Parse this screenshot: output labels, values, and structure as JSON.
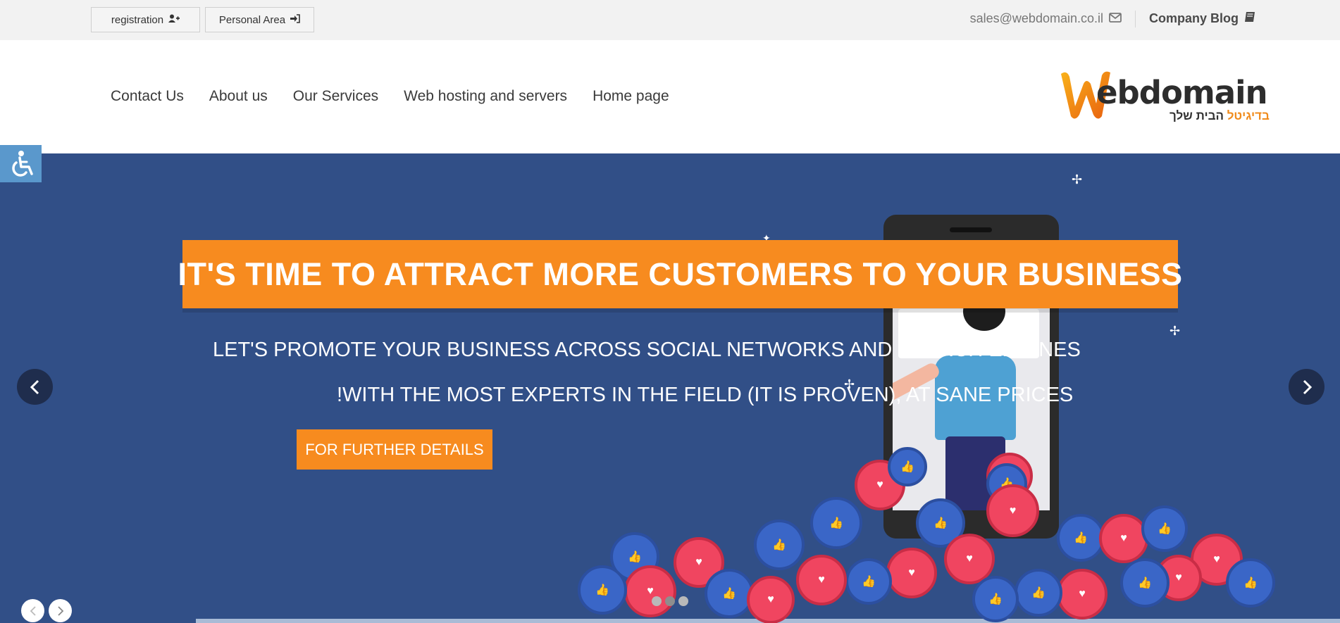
{
  "topbar": {
    "registration_label": "registration",
    "registration_icon": "user-plus-icon",
    "personal_area_label": "Personal Area",
    "personal_area_icon": "sign-in-icon",
    "email": "sales@webdomain.co.il",
    "email_icon": "envelope-icon",
    "blog_label": "Company Blog",
    "blog_icon": "book-icon"
  },
  "nav": {
    "items": [
      {
        "label": "Contact Us"
      },
      {
        "label": "About us"
      },
      {
        "label": "Our Services"
      },
      {
        "label": "Web hosting and servers"
      },
      {
        "label": "Home page"
      }
    ]
  },
  "logo": {
    "text": "ebdomain",
    "tagline_dark": "הבית שלך",
    "tagline_orange": "בדיגיטל"
  },
  "accessibility": {
    "icon": "wheelchair-icon"
  },
  "hero": {
    "headline": "IT'S TIME TO ATTRACT MORE CUSTOMERS TO YOUR BUSINESS",
    "subtitle_line1": "LET'S PROMOTE YOUR BUSINESS ACROSS SOCIAL NETWORKS AND SEARCH ENGINES",
    "subtitle_line2": "!WITH THE MOST EXPERTS IN THE FIELD (IT IS PROVEN), AT SANE PRICES",
    "cta_label": "FOR FURTHER DETAILS",
    "slide_count": 3,
    "active_slide": 2
  },
  "colors": {
    "hero_bg": "#314f87",
    "accent_orange": "#f78b1f",
    "topbar_bg": "#f2f2f2",
    "accessibility_bg": "#5a98cc"
  }
}
